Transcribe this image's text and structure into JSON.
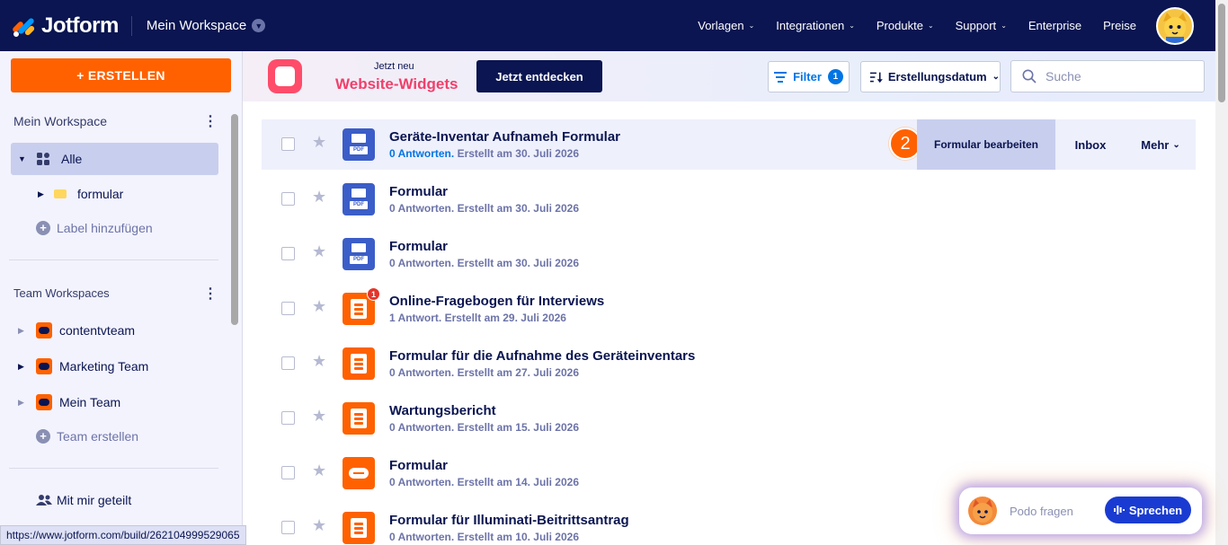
{
  "header": {
    "brand": "Jotform",
    "workspace": "Mein Workspace",
    "nav": [
      {
        "label": "Vorlagen",
        "dropdown": true
      },
      {
        "label": "Integrationen",
        "dropdown": true
      },
      {
        "label": "Produkte",
        "dropdown": true
      },
      {
        "label": "Support",
        "dropdown": true
      },
      {
        "label": "Enterprise",
        "dropdown": false
      },
      {
        "label": "Preise",
        "dropdown": false
      }
    ]
  },
  "sidebar": {
    "create_label": "+ ERSTELLEN",
    "my_workspace_title": "Mein Workspace",
    "all_label": "Alle",
    "folder_label": "formular",
    "add_label": "Label hinzufügen",
    "team_title": "Team Workspaces",
    "teams": [
      "contentvteam",
      "Marketing Team",
      "Mein Team"
    ],
    "create_team_label": "Team erstellen",
    "shared_label": "Mit mir geteilt"
  },
  "promo": {
    "kicker": "Jetzt neu",
    "title": "Website-Widgets",
    "button": "Jetzt entdecken"
  },
  "toolbar": {
    "filter_label": "Filter",
    "filter_count": "1",
    "sort_label": "Erstellungsdatum",
    "search_placeholder": "Suche"
  },
  "forms": [
    {
      "title": "Geräte-Inventar Aufnameh Formular",
      "responses": "0 Antworten.",
      "created": "Erstellt am 30. Juli 2026",
      "icon": "pdf"
    },
    {
      "title": "Formular",
      "responses": "0 Antworten.",
      "created": "Erstellt am 30. Juli 2026",
      "icon": "pdf"
    },
    {
      "title": "Formular",
      "responses": "0 Antworten.",
      "created": "Erstellt am 30. Juli 2026",
      "icon": "pdf"
    },
    {
      "title": "Online-Fragebogen für Interviews",
      "responses": "1 Antwort.",
      "created": "Erstellt am 29. Juli 2026",
      "icon": "form",
      "notification": "1"
    },
    {
      "title": "Formular für die Aufnahme des Geräteinventars",
      "responses": "0 Antworten.",
      "created": "Erstellt am 27. Juli 2026",
      "icon": "form"
    },
    {
      "title": "Wartungsbericht",
      "responses": "0 Antworten.",
      "created": "Erstellt am 15. Juli 2026",
      "icon": "form"
    },
    {
      "title": "Formular",
      "responses": "0 Antworten.",
      "created": "Erstellt am 14. Juli 2026",
      "icon": "card"
    },
    {
      "title": "Formular für Illuminati-Beitrittsantrag",
      "responses": "0 Antworten.",
      "created": "Erstellt am 10. Juli 2026",
      "icon": "form"
    }
  ],
  "row_actions": {
    "edit": "Formular bearbeiten",
    "inbox": "Inbox",
    "more": "Mehr"
  },
  "step_badge": "2",
  "status_url": "https://www.jotform.com/build/262104999529065",
  "assistant": {
    "placeholder": "Podo fragen",
    "button": "Sprechen"
  },
  "colors": {
    "navy": "#0a1551",
    "orange": "#ff6100",
    "blue": "#0075e3",
    "pdf_blue": "#3b5dc8"
  }
}
